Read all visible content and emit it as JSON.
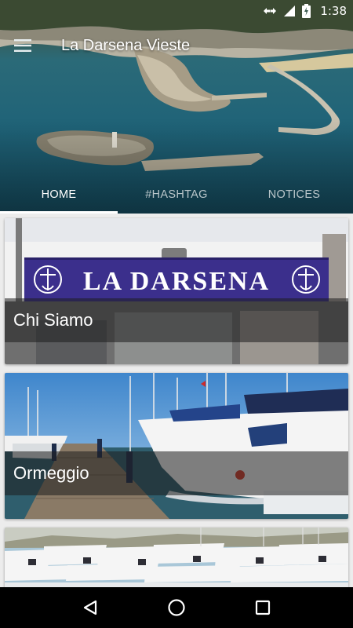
{
  "status_bar": {
    "time": "1:38",
    "icons": [
      "data-arrows-icon",
      "signal-icon",
      "battery-charging-icon"
    ]
  },
  "app_bar": {
    "title": "La Darsena Vieste",
    "menu_icon": "hamburger-menu-icon"
  },
  "tabs": [
    {
      "label": "HOME",
      "active": true
    },
    {
      "label": "#HASHTAG",
      "active": false
    },
    {
      "label": "NOTICES",
      "active": false
    }
  ],
  "cards": [
    {
      "label": "Chi Siamo",
      "sign_text": "LA DARSENA"
    },
    {
      "label": "Ormeggio"
    },
    {
      "label": ""
    }
  ],
  "nav_bar": {
    "icons": [
      "back-icon",
      "home-icon",
      "recents-icon"
    ]
  },
  "colors": {
    "sea": "#1f6378",
    "nav_background": "#000000",
    "sign_blue": "#3b2f8c"
  }
}
